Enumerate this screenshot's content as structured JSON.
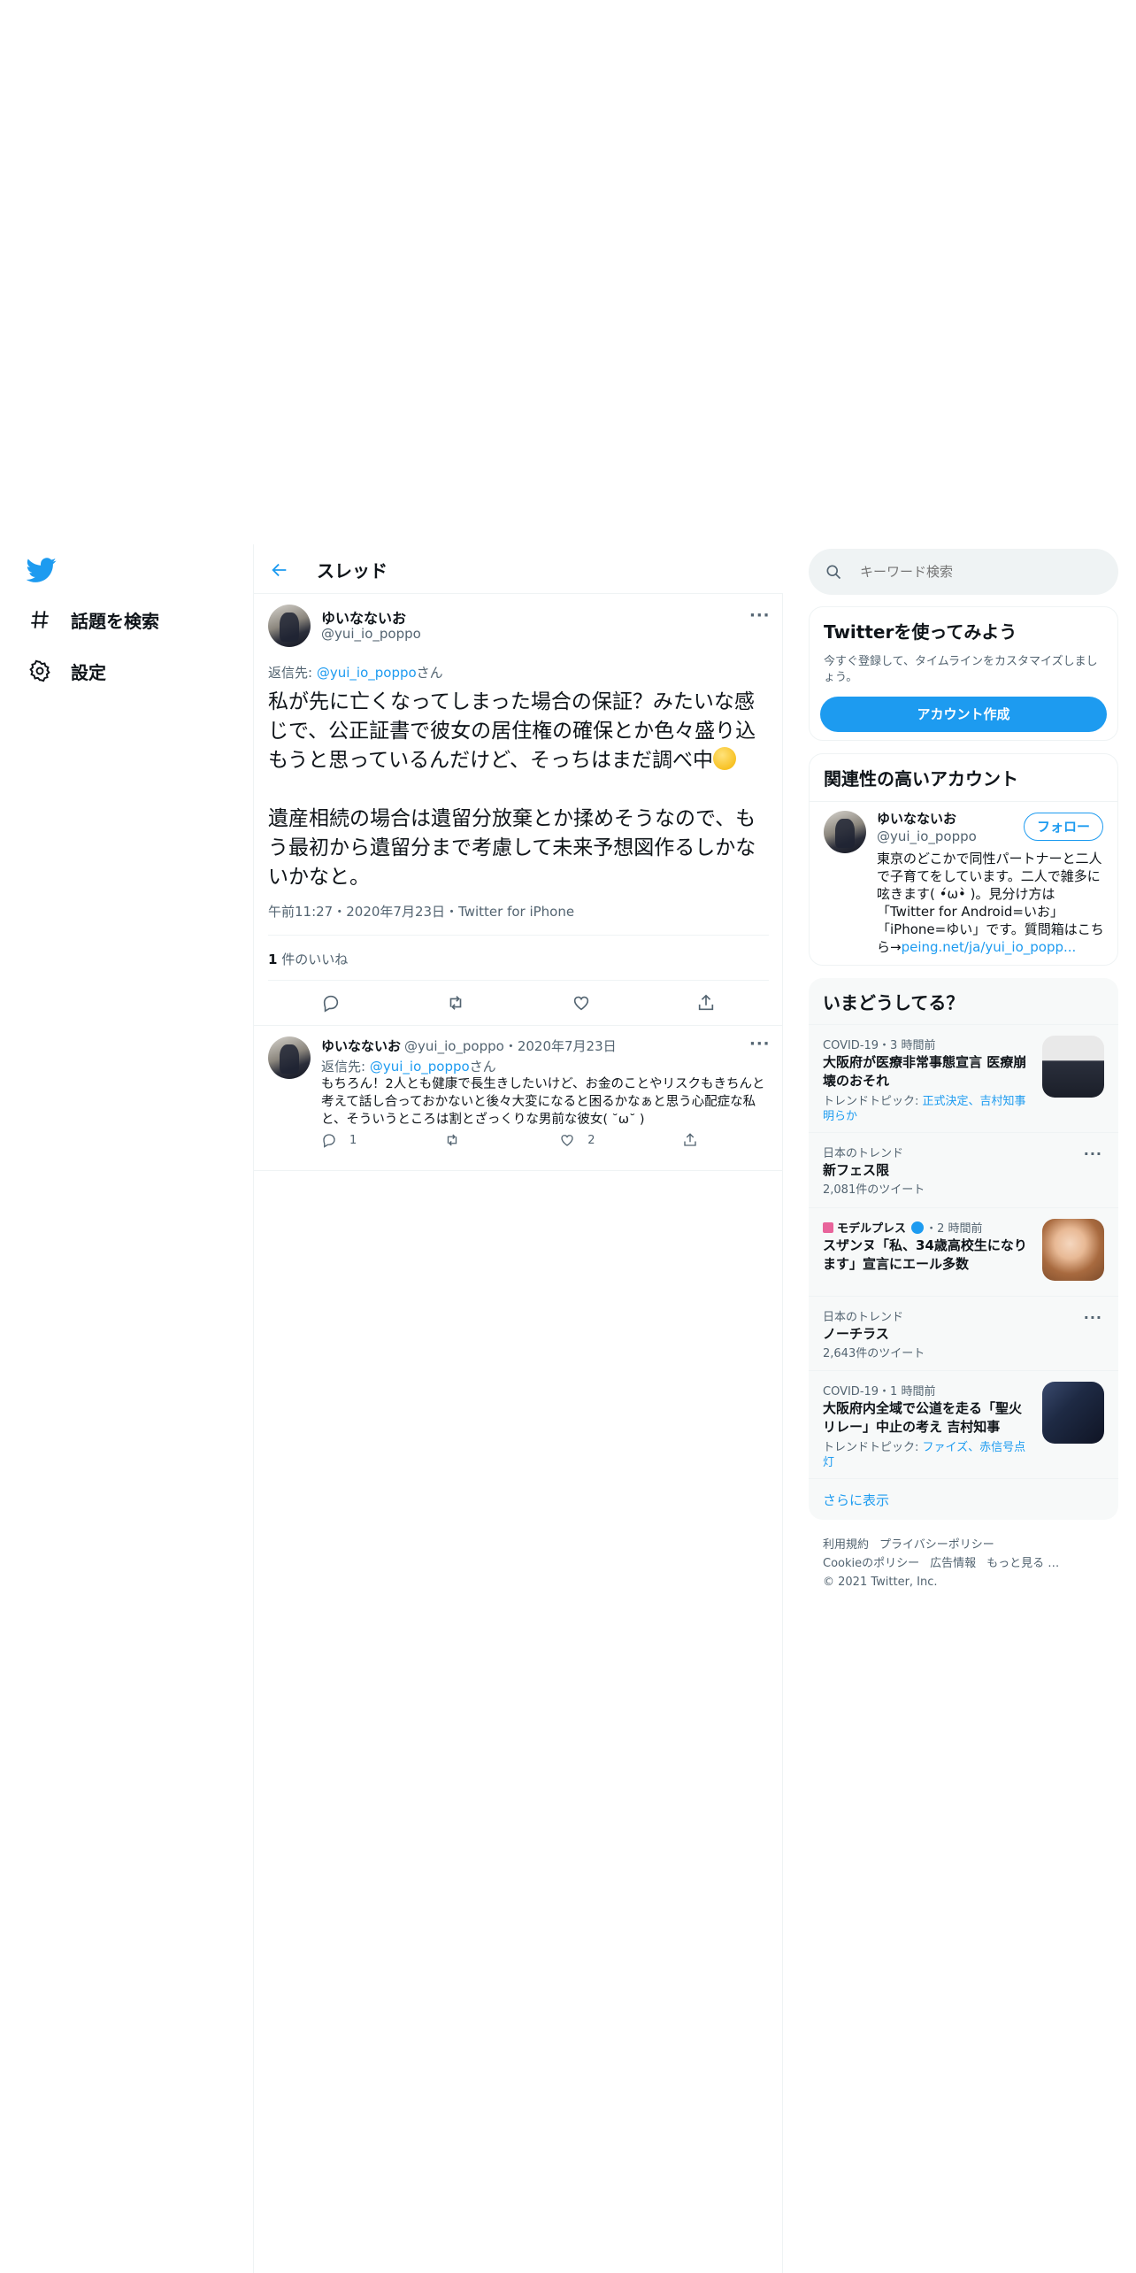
{
  "nav": {
    "items": [
      {
        "label": "話題を検索",
        "icon": "hashtag-icon"
      },
      {
        "label": "設定",
        "icon": "gear-icon"
      }
    ]
  },
  "header": {
    "title": "スレッド"
  },
  "main_tweet": {
    "name": "ゆいなないお",
    "handle": "@yui_io_poppo",
    "reply_to_label": "返信先:",
    "reply_to_handle": "@yui_io_poppo",
    "reply_to_suffix": "さん",
    "text_part1": "私が先に亡くなってしまった場合の保証？みたいな感じで、公正証書で彼女の居住権の確保とか色々盛り込もうと思っているんだけど、そっちはまだ調べ中",
    "text_part2": "遺産相続の場合は遺留分放棄とか揉めそうなので、もう最初から遺留分まで考慮して未来予想図作るしかないかなと。",
    "meta": "午前11:27・2020年7月23日・Twitter for iPhone",
    "likes_count": "1",
    "likes_label": " 件のいいね"
  },
  "reply_tweet": {
    "name": "ゆいなないお",
    "handle_date": "@yui_io_poppo・2020年7月23日",
    "reply_to_label": "返信先:",
    "reply_to_handle": "@yui_io_poppo",
    "reply_to_suffix": "さん",
    "text": "もちろん！2人とも健康で長生きしたいけど、お金のことやリスクもきちんと考えて話し合っておかないと後々大変になると困るかなぁと思う心配症な私と、そういうところは割とざっくりな男前な彼女( ˘ω˘ )",
    "reply_count": "1",
    "like_count": "2"
  },
  "search": {
    "placeholder": "キーワード検索"
  },
  "signup": {
    "title": "Twitterを使ってみよう",
    "desc": "今すぐ登録して、タイムラインをカスタマイズしましょう。",
    "button": "アカウント作成"
  },
  "related": {
    "title": "関連性の高いアカウント",
    "name": "ゆいなないお",
    "handle": "@yui_io_poppo",
    "follow": "フォロー",
    "bio": "東京のどこかで同性パートナーと二人で子育てをしています。二人で雑多に呟きます( •́ω•̀ )。見分け方は「Twitter for Android=いお」「iPhone=ゆい」です。質問箱はこちら→",
    "bio_link": "peing.net/ja/yui_io_popp..."
  },
  "trends": {
    "title": "いまどうしてる？",
    "items": [
      {
        "meta": "COVID-19・3 時間前",
        "title": "大阪府が医療非常事態宣言 医療崩壊のおそれ",
        "sub_label": "トレンドトピック: ",
        "sub_link": "正式決定、吉村知事明らか"
      },
      {
        "meta": "日本のトレンド",
        "title": "新フェス限",
        "sub": "2,081件のツイート"
      },
      {
        "meta_source": "モデルプレス",
        "meta_time": "・2 時間前",
        "title": "スザンヌ「私、34歳高校生になります」宣言にエール多数"
      },
      {
        "meta": "日本のトレンド",
        "title": "ノーチラス",
        "sub": "2,643件のツイート"
      },
      {
        "meta": "COVID-19・1 時間前",
        "title": "大阪府内全域で公道を走る「聖火リレー」中止の考え 吉村知事",
        "sub_label": "トレンドトピック: ",
        "sub_link": "ファイズ、赤信号点灯"
      }
    ],
    "show_more": "さらに表示"
  },
  "footer": {
    "links1": [
      "利用規約",
      "プライバシーポリシー"
    ],
    "links2": [
      "Cookieのポリシー",
      "広告情報",
      "もっと見る …"
    ],
    "copyright": "© 2021 Twitter, Inc."
  },
  "colors": {
    "accent": "#1d9bf0",
    "text": "#0f1419",
    "muted": "#536471",
    "border": "#eff3f4"
  }
}
